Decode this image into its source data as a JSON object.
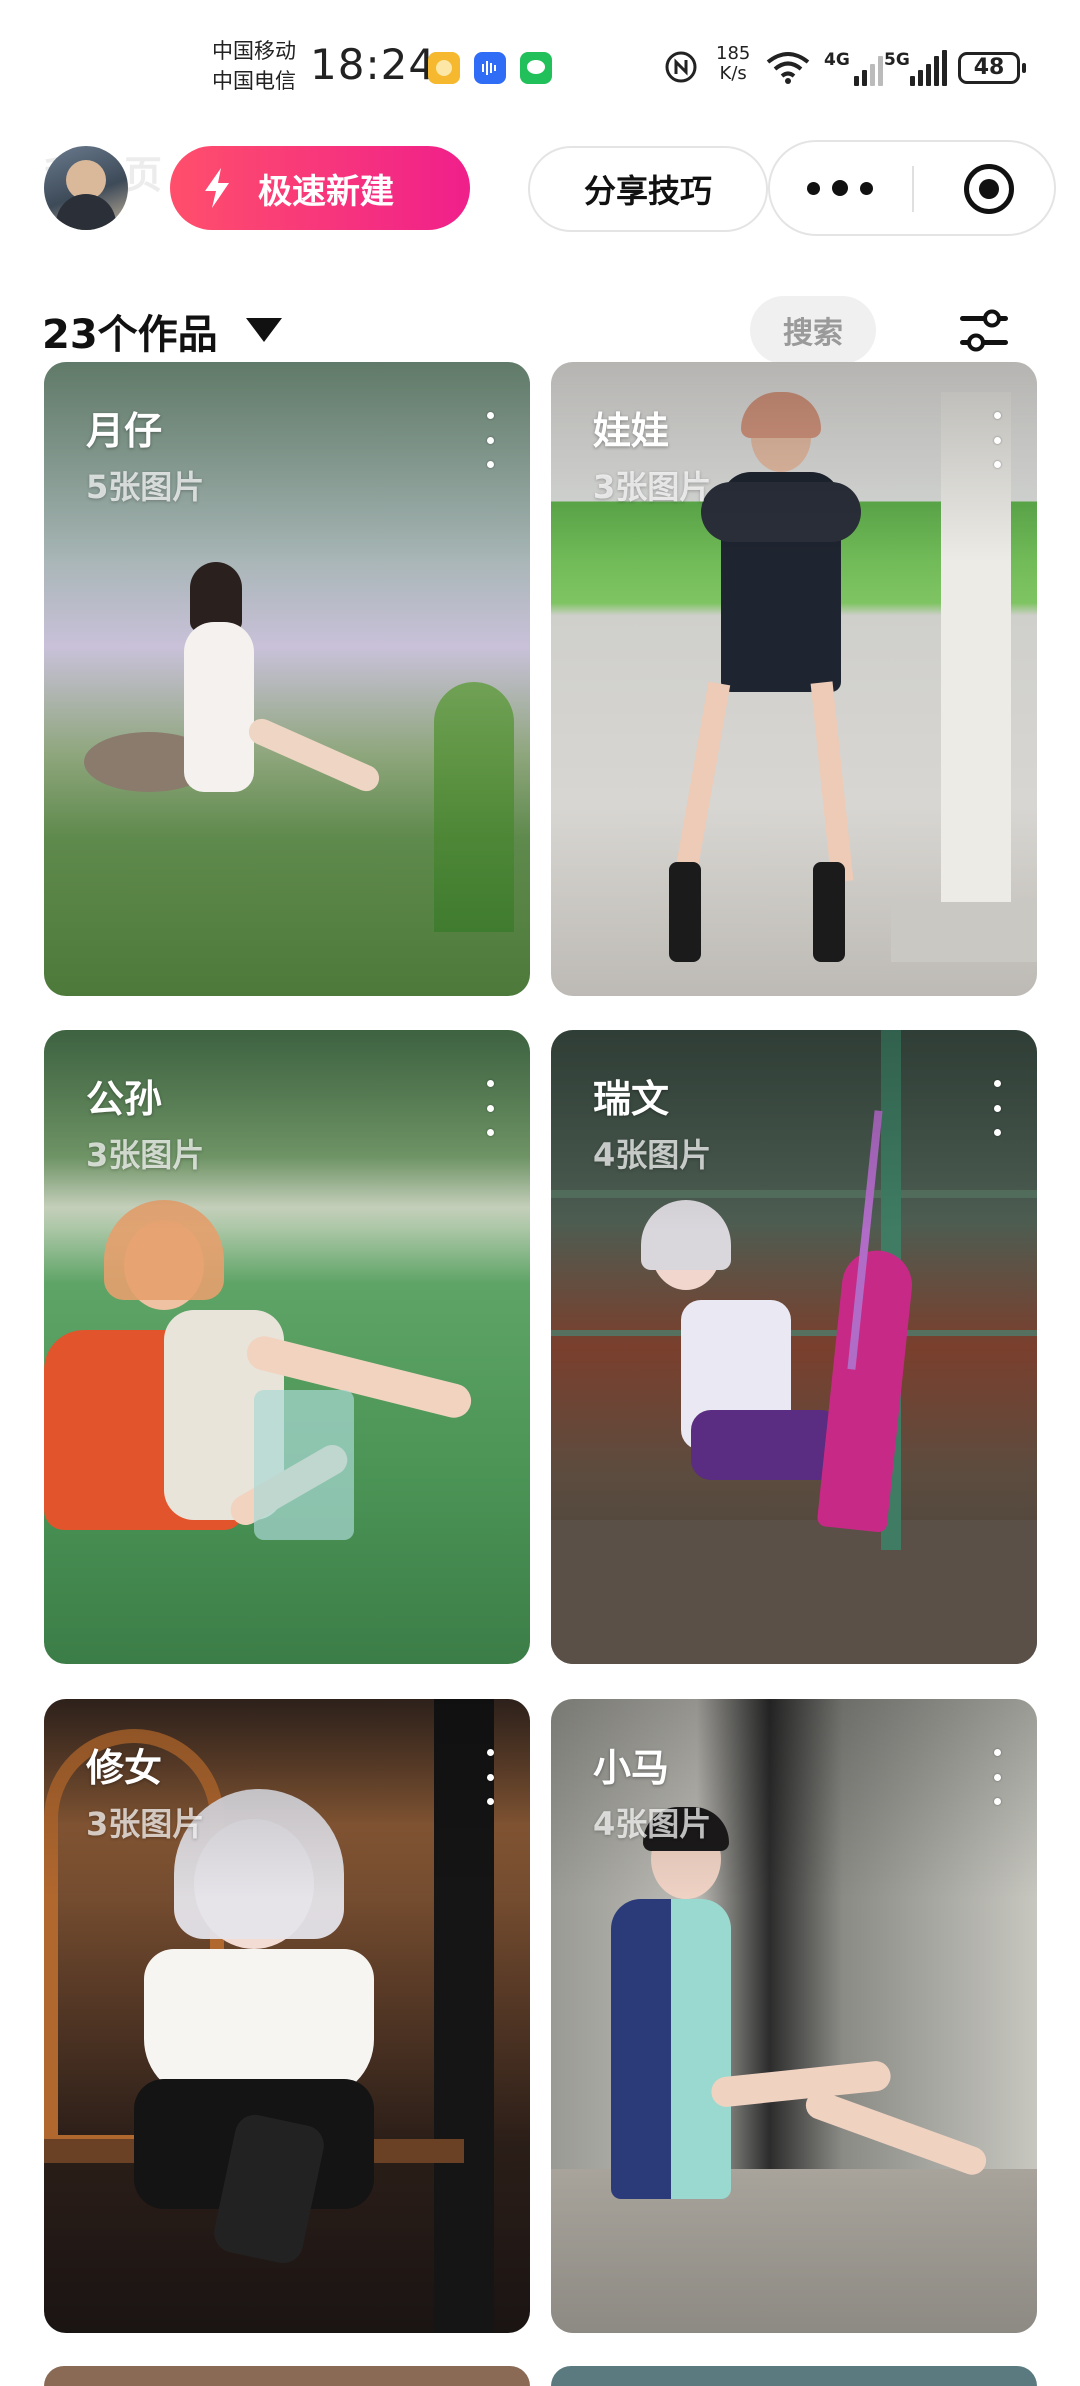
{
  "status_bar": {
    "carrier_1": "中国移动",
    "carrier_2": "中国电信",
    "time": "18:24",
    "speed_value": "185",
    "speed_unit": "K/s",
    "net_1": "4G",
    "net_2": "5G",
    "battery": "48"
  },
  "header": {
    "ghost_title": "我主页",
    "new_button": "极速新建",
    "share_button": "分享技巧"
  },
  "toolbar": {
    "works_count": "23个作品",
    "search": "搜索"
  },
  "colors": {
    "accent_start": "#ff4f6b",
    "accent_end": "#f01f8b"
  },
  "works": [
    {
      "name": "月仔",
      "count": "5张图片"
    },
    {
      "name": "娃娃",
      "count": "3张图片"
    },
    {
      "name": "公孙",
      "count": "3张图片"
    },
    {
      "name": "瑞文",
      "count": "4张图片"
    },
    {
      "name": "修女",
      "count": "3张图片"
    },
    {
      "name": "小马",
      "count": "4张图片"
    }
  ]
}
